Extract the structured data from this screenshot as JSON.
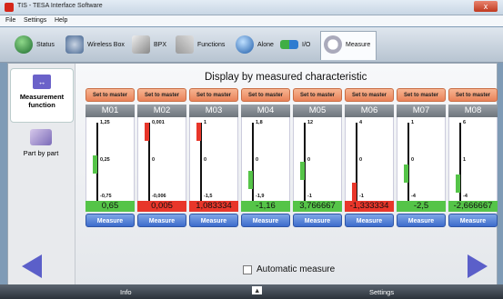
{
  "window": {
    "title": "TIS - TESA Interface Software",
    "close_glyph": "x"
  },
  "menu": [
    "File",
    "Settings",
    "Help"
  ],
  "toolbar": [
    {
      "label": "Status",
      "icon": "status-globe-icon"
    },
    {
      "label": "Wireless Box",
      "icon": "wireless-box-icon"
    },
    {
      "label": "BPX",
      "icon": "bpx-icon"
    },
    {
      "label": "Functions",
      "icon": "functions-tools-icon"
    },
    {
      "label": "Alone",
      "icon": "alone-icon"
    },
    {
      "label": "I/O",
      "icon": "io-arrows-icon"
    },
    {
      "label": "Measure",
      "icon": "measure-icon"
    }
  ],
  "sidebar": [
    {
      "label": "Measurement function",
      "icon": "measurement-function-icon"
    },
    {
      "label": "Part by part",
      "icon": "part-by-part-icon"
    }
  ],
  "main_title": "Display by measured characteristic",
  "set_master_label": "Set to master",
  "measure_label": "Measure",
  "automatic_measure": "Automatic measure",
  "colors": {
    "green": "#55c448",
    "red": "#e8362a",
    "accent": "#5b5fc9"
  },
  "characteristics": [
    {
      "name": "M01",
      "top": "1,25",
      "mid": "0,25",
      "bottom": "-0,75",
      "value": "0,65",
      "status": "green",
      "level": 0.45
    },
    {
      "name": "M02",
      "top": "0,001",
      "mid": "0",
      "bottom": "-0,006",
      "value": "0,005",
      "status": "red",
      "level": 1.0
    },
    {
      "name": "M03",
      "top": "1",
      "mid": "0",
      "bottom": "-1,5",
      "value": "1,083334",
      "status": "red",
      "level": 1.0
    },
    {
      "name": "M04",
      "top": "1,8",
      "mid": "0",
      "bottom": "-1,9",
      "value": "-1,16",
      "status": "green",
      "level": 0.2
    },
    {
      "name": "M05",
      "top": "12",
      "mid": "0",
      "bottom": "-1",
      "value": "3,766667",
      "status": "green",
      "level": 0.35
    },
    {
      "name": "M06",
      "top": "4",
      "mid": "0",
      "bottom": "-1",
      "value": "-1,333334",
      "status": "red",
      "level": 0.0
    },
    {
      "name": "M07",
      "top": "1",
      "mid": "0",
      "bottom": "-4",
      "value": "-2,5",
      "status": "green",
      "level": 0.3
    },
    {
      "name": "M08",
      "top": "6",
      "mid": "1",
      "bottom": "-4",
      "value": "-2,666667",
      "status": "green",
      "level": 0.13
    }
  ],
  "status": {
    "info": "Info",
    "up": "▲",
    "settings": "Settings"
  }
}
